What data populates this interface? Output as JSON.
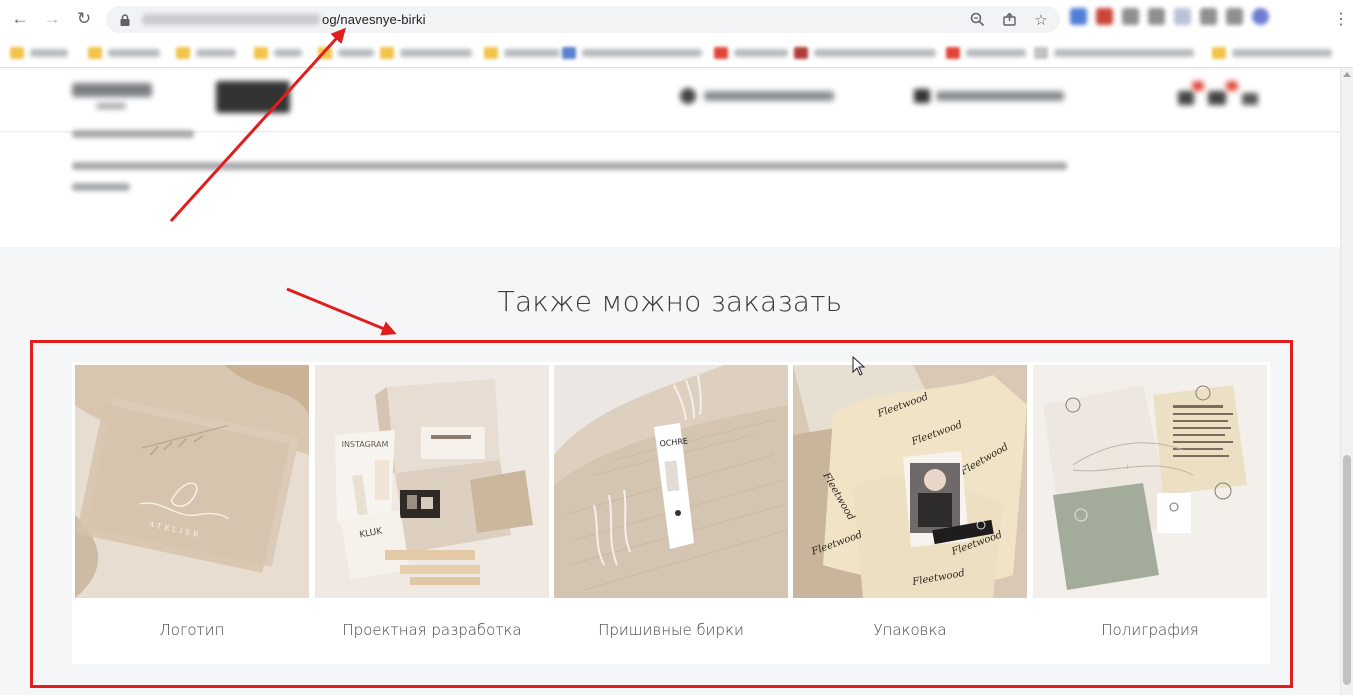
{
  "browser": {
    "url_path": "og/navesnye-birki",
    "ext_colors": [
      "#4f7fd6",
      "#c9453a",
      "#8f8f8f",
      "#8f8f8f",
      "#b9c3d6",
      "#8f8f8f",
      "#8f8f8f",
      "#6d7bd1"
    ],
    "bookmark_colors": [
      "#f3c44a",
      "#f3c44a",
      "#f3c44a",
      "#f3c44a",
      "#f3c44a",
      "#f3c44a",
      "#f3c44a",
      "#5a7fce",
      "#e0453a",
      "#b03a3a",
      "#e0453a",
      "#c2c2c2",
      "#f3c44a"
    ],
    "omni_icons": [
      "zoom-icon",
      "share-icon",
      "star-icon"
    ]
  },
  "section": {
    "title": "Также можно заказать"
  },
  "cards": [
    {
      "label": "Логотип",
      "image": "logo-card-image"
    },
    {
      "label": "Проектная разработка",
      "image": "project-kit-image"
    },
    {
      "label": "Пришивные бирки",
      "image": "sewn-tag-image"
    },
    {
      "label": "Упаковка",
      "image": "packaging-image"
    },
    {
      "label": "Полиграфия",
      "image": "printing-image"
    }
  ],
  "annotation": {
    "color": "#e01e1e"
  }
}
